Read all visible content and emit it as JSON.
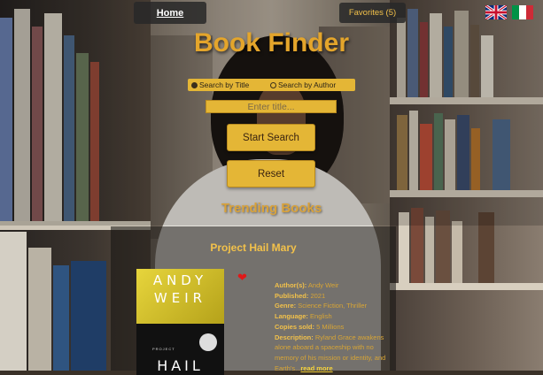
{
  "nav": {
    "home_label": "Home",
    "favorites_label": "Favorites (5)"
  },
  "languages": [
    {
      "name": "uk-flag-icon"
    },
    {
      "name": "italy-flag-icon"
    }
  ],
  "app": {
    "title": "Book Finder"
  },
  "search": {
    "options": [
      {
        "label": "Search by Title",
        "selected": true
      },
      {
        "label": "Search by Author",
        "selected": false
      }
    ],
    "placeholder": "Enter title...",
    "start_label": "Start Search",
    "reset_label": "Reset"
  },
  "trending": {
    "heading": "Trending Books",
    "book": {
      "title": "Project Hail Mary",
      "cover_text": {
        "author_line1": "ANDY",
        "author_line2": "WEIR",
        "project": "PROJECT",
        "hail": "HAIL"
      },
      "details": [
        {
          "key": "Author(s):",
          "value": "Andy Weir"
        },
        {
          "key": "Published:",
          "value": "2021"
        },
        {
          "key": "Genre:",
          "value": "Science Fiction, Thriller"
        },
        {
          "key": "Language:",
          "value": "English"
        },
        {
          "key": "Copies sold:",
          "value": "5 Millions"
        }
      ],
      "description_key": "Description:",
      "description": "Ryland Grace awakens alone aboard a spaceship with no memory of his mission or identity, and Earth's...",
      "read_more": "read more"
    }
  },
  "colors": {
    "accent": "#e4b636",
    "title": "#e4a52b",
    "heart": "#e01818"
  }
}
